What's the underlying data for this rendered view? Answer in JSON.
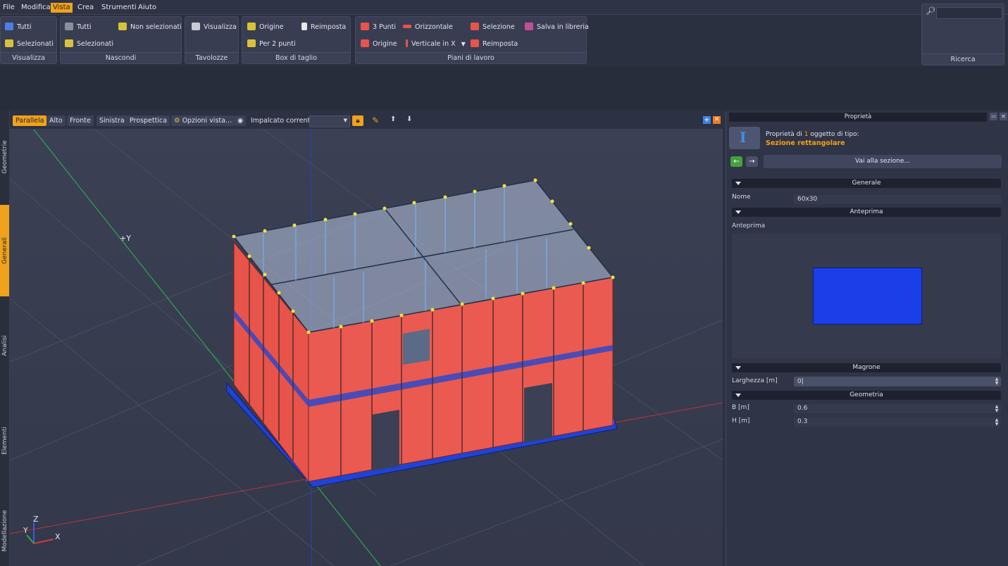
{
  "menubar": {
    "items": [
      {
        "label": "File"
      },
      {
        "label": "Modifica"
      },
      {
        "label": "Vista"
      },
      {
        "label": "Crea"
      },
      {
        "label": "Strumenti"
      },
      {
        "label": "Aiuto"
      }
    ],
    "active": "Vista"
  },
  "ribbon": {
    "visualizza": {
      "caption": "Visualizza",
      "tutti": "Tutti",
      "selezionati": "Selezionati"
    },
    "nascondi": {
      "caption": "Nascondi",
      "tutti": "Tutti",
      "non_selezionati": "Non selezionati",
      "selezionati": "Selezionati"
    },
    "tavolozze": {
      "caption": "Tavolozze",
      "visualizza": "Visualizza"
    },
    "box": {
      "caption": "Box di taglio",
      "origine": "Origine",
      "reimposta": "Reimposta",
      "per2punti": "Per 2 punti"
    },
    "piani": {
      "caption": "Piani di lavoro",
      "tre_punti": "3 Punti",
      "orizzontale": "Orizzontale",
      "selezione": "Selezione",
      "salva": "Salva in libreria",
      "origine": "Origine",
      "verticale": "Verticale in X",
      "reimposta": "Reimposta"
    },
    "ricerca": {
      "caption": "Ricerca"
    }
  },
  "side_tabs": [
    "Geometrie",
    "Generali",
    "Analisi",
    "Elementi",
    "Modellazione"
  ],
  "view_toolbar": {
    "views": [
      "Parallela",
      "Alto",
      "Fronte",
      "Sinistra",
      "Prospettica"
    ],
    "options": "Opzioni vista...",
    "impalcato_label": "Impalcato corrente:"
  },
  "viewport": {
    "axis_y_label": "+Y",
    "triad": {
      "z": "Z",
      "y": "Y",
      "x": "X"
    }
  },
  "properties": {
    "title": "Proprietà",
    "header_prefix": "Proprietà di",
    "count": "1",
    "header_suffix": "oggetto di tipo:",
    "type": "Sezione rettangolare",
    "goto": "Vai alla sezione...",
    "sections": {
      "generale": "Generale",
      "anteprima": "Anteprima",
      "magrone": "Magrone",
      "geometria": "Geometria"
    },
    "nome_label": "Nome",
    "nome_value": "60x30",
    "anteprima_label": "Anteprima",
    "larghezza_label": "Larghezza [m]",
    "larghezza_value": "0|",
    "b_label": "B [m]",
    "b_value": "0.6",
    "h_label": "H [m]",
    "h_value": "0.3"
  },
  "colors": {
    "accent": "#f0a21a",
    "wall": "#e8534a",
    "foundation": "#1f43d6",
    "preview": "#1a3ee8"
  }
}
